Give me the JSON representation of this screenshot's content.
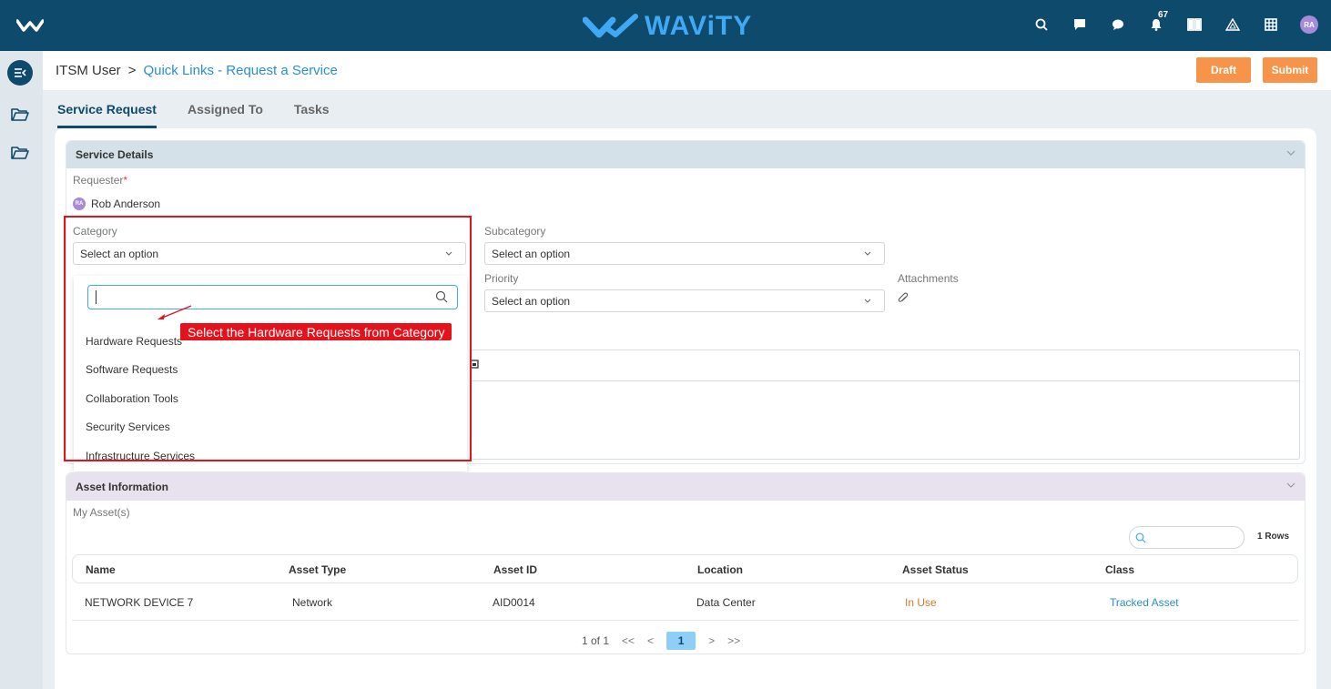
{
  "topbar": {
    "brand": "WAViTY",
    "notification_count": "67",
    "avatar_initials": "RA"
  },
  "header": {
    "breadcrumb_root": "ITSM User",
    "breadcrumb_sep": ">",
    "breadcrumb_current": "Quick Links - Request a Service",
    "draft_label": "Draft",
    "submit_label": "Submit"
  },
  "tabs": [
    {
      "label": "Service Request",
      "active": true
    },
    {
      "label": "Assigned To",
      "active": false
    },
    {
      "label": "Tasks",
      "active": false
    }
  ],
  "service": {
    "title": "Service Details",
    "requester_label": "Requester",
    "required_mark": "*",
    "requester_initials": "RA",
    "requester_name": "Rob Anderson",
    "category_label": "Category",
    "category_value": "Select an option",
    "subcategory_label": "Subcategory",
    "subcategory_value": "Select an option",
    "priority_label": "Priority",
    "priority_value": "Select an option",
    "attachments_label": "Attachments",
    "dropdown_options": [
      "Hardware Requests",
      "Software Requests",
      "Collaboration Tools",
      "Security Services",
      "Infrastructure Services"
    ]
  },
  "annotation": {
    "callout_text": "Select the Hardware Requests from Category",
    "color": "#e3121b"
  },
  "asset": {
    "title": "Asset Information",
    "my_assets_label": "My Asset(s)",
    "rows_count": "1 Rows",
    "columns": [
      "Name",
      "Asset Type",
      "Asset ID",
      "Location",
      "Asset Status",
      "Class"
    ],
    "rows": [
      [
        "NETWORK DEVICE 7",
        "Network",
        "AID0014",
        "Data Center",
        "In Use",
        "Tracked Asset"
      ]
    ],
    "pager": {
      "summary": "1 of 1",
      "first": "<<",
      "prev": "<",
      "current": "1",
      "next": ">",
      "last": ">>"
    }
  },
  "colors": {
    "topbar": "#0e4a6b",
    "accent": "#f7944a",
    "link": "#2b8fc9"
  }
}
